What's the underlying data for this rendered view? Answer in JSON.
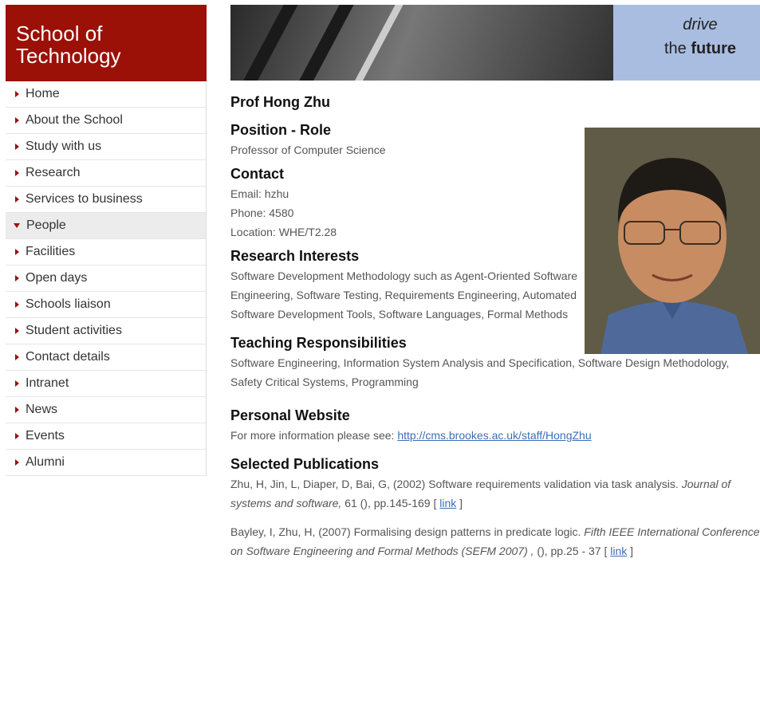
{
  "sidebar": {
    "brand": [
      "School of",
      "Technology"
    ],
    "items": [
      {
        "label": "Home"
      },
      {
        "label": "About the School"
      },
      {
        "label": "Study with us"
      },
      {
        "label": "Research"
      },
      {
        "label": "Services to business"
      },
      {
        "label": "People",
        "active": true
      },
      {
        "label": "Facilities"
      },
      {
        "label": "Open days"
      },
      {
        "label": "Schools liaison"
      },
      {
        "label": "Student activities"
      },
      {
        "label": "Contact details"
      },
      {
        "label": "Intranet"
      },
      {
        "label": "News"
      },
      {
        "label": "Events"
      },
      {
        "label": "Alumni"
      }
    ]
  },
  "banner": {
    "drive": "drive",
    "the": "the",
    "future": "future"
  },
  "profile": {
    "name": "Prof Hong Zhu",
    "position_heading": "Position - Role",
    "position": "Professor of Computer Science",
    "contact_heading": "Contact",
    "email": "Email: hzhu",
    "phone": "Phone: 4580",
    "location": "Location: WHE/T2.28",
    "research_heading": "Research Interests",
    "research": "Software Development Methodology such as Agent-Oriented Software Engineering, Software Testing, Requirements Engineering, Automated Software Development Tools, Software Languages, Formal Methods",
    "teaching_heading": "Teaching Responsibilities",
    "teaching": "Software Engineering, Information System Analysis and Specification, Software Design Methodology, Safety Critical Systems, Programming",
    "website_heading": "Personal Website",
    "website_prefix": "For more information please see: ",
    "website_link": "http://cms.brookes.ac.uk/staff/HongZhu",
    "publications_heading": "Selected Publications",
    "publications": [
      {
        "text": "Zhu, H, Jin, L, Diaper, D, Bai, G, (2002) Software requirements validation via task analysis.",
        "venue": "Journal of systems and software,",
        "rest": " 61 (), pp.145-169 [ ",
        "link": "link",
        "close": " ]"
      },
      {
        "text": "Bayley, I, Zhu, H, (2007) Formalising design patterns in predicate logic.",
        "venue": "Fifth IEEE International Conference on Software Engineering and Formal Methods (SEFM 2007) ,",
        "rest": " (), pp.25 - 37 [ ",
        "link": "link",
        "close": " ]"
      }
    ]
  }
}
